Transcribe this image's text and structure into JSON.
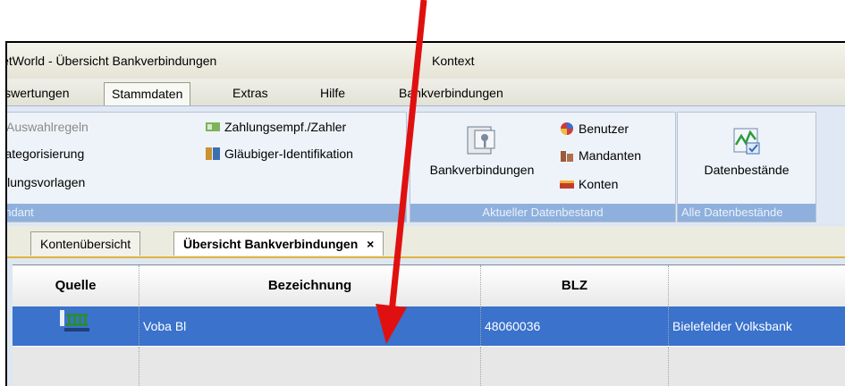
{
  "window": {
    "title": "NetWorld - Übersicht Bankverbindungen",
    "context": "Kontext"
  },
  "menu": {
    "tabs": [
      {
        "label": "Auswertungen"
      },
      {
        "label": "Stammdaten"
      },
      {
        "label": "Extras"
      },
      {
        "label": "Hilfe"
      },
      {
        "label": "Bankverbindungen"
      }
    ]
  },
  "ribbon": {
    "group1": {
      "items": [
        "Auswahlregeln",
        "Regeln für autom. Kategorisierung",
        "Zahlungsvorlagen",
        "Zahlungsempf./Zahler",
        "Gläubiger-Identifikation"
      ],
      "label": "Aktueller Mandant"
    },
    "group2": {
      "big_button": "Bankverbindungen",
      "items": [
        "Benutzer",
        "Mandanten",
        "Konten"
      ],
      "label": "Aktueller Datenbestand"
    },
    "group3": {
      "big_button": "Datenbestände",
      "label": "Alle Datenbestände"
    }
  },
  "doc_tabs": [
    {
      "label": "Kontenübersicht"
    },
    {
      "label": "Übersicht Bankverbindungen",
      "close": "×"
    }
  ],
  "grid": {
    "columns": [
      "Quelle",
      "Bezeichnung",
      "BLZ",
      ""
    ],
    "rows": [
      {
        "quelle_icon": "bank-icon",
        "bezeichnung": "Voba Bl",
        "blz": "48060036",
        "bank": "Bielefelder Volksbank"
      }
    ]
  },
  "colors": {
    "selection": "#3a72cc",
    "arrow": "#e01010",
    "group_label": "#8fb0dd"
  }
}
